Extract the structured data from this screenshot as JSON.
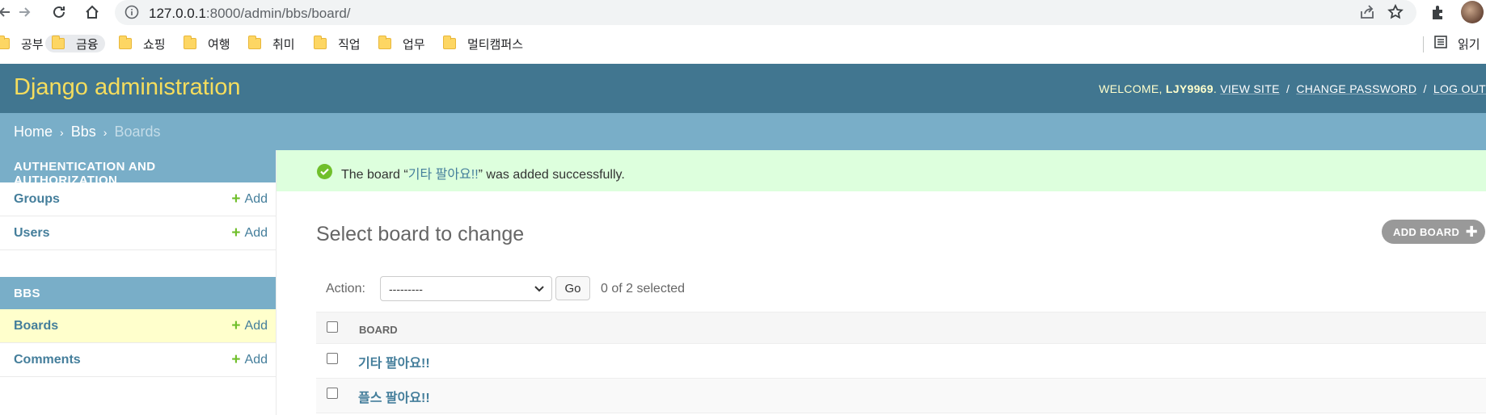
{
  "browser": {
    "url_host": "127.0.0.1",
    "url_path": ":8000/admin/bbs/board/",
    "bookmarks": [
      {
        "label": "공부"
      },
      {
        "label": "금융"
      },
      {
        "label": "쇼핑"
      },
      {
        "label": "여행"
      },
      {
        "label": "취미"
      },
      {
        "label": "직업"
      },
      {
        "label": "업무"
      },
      {
        "label": "멀티캠퍼스"
      }
    ],
    "reading_list_label": "읽기"
  },
  "header": {
    "branding": "Django administration",
    "welcome": "Welcome,",
    "username": "LJY9969",
    "view_site": "View site",
    "change_password": "Change password",
    "log_out": "Log out",
    "separator": "/"
  },
  "breadcrumbs": {
    "home": "Home",
    "app": "Bbs",
    "current": "Boards",
    "arrow": "›"
  },
  "sidebar": {
    "modules": [
      {
        "caption": "Authentication and Authorization",
        "models": [
          {
            "name": "Groups",
            "add": "Add"
          },
          {
            "name": "Users",
            "add": "Add"
          }
        ]
      },
      {
        "caption": "BBS",
        "models": [
          {
            "name": "Boards",
            "add": "Add"
          },
          {
            "name": "Comments",
            "add": "Add"
          }
        ]
      }
    ]
  },
  "message": {
    "prefix": "The board “",
    "object": "기타 팔아요!!",
    "suffix": "” was added successfully."
  },
  "content": {
    "title": "Select board to change",
    "add_button": "Add board",
    "action_label": "Action:",
    "action_selected": "---------",
    "go_button": "Go",
    "counter": "0 of 2 selected",
    "column_header": "Board",
    "rows": [
      {
        "title": "기타 팔아요!!"
      },
      {
        "title": "플스 팔아요!!"
      }
    ]
  },
  "colors": {
    "header_bg": "#417690",
    "branding": "#f5dd5d",
    "breadcrumb_bg": "#79aec8",
    "link": "#447e9b",
    "success_bg": "#dddddd",
    "add_green": "#70bf2b"
  }
}
